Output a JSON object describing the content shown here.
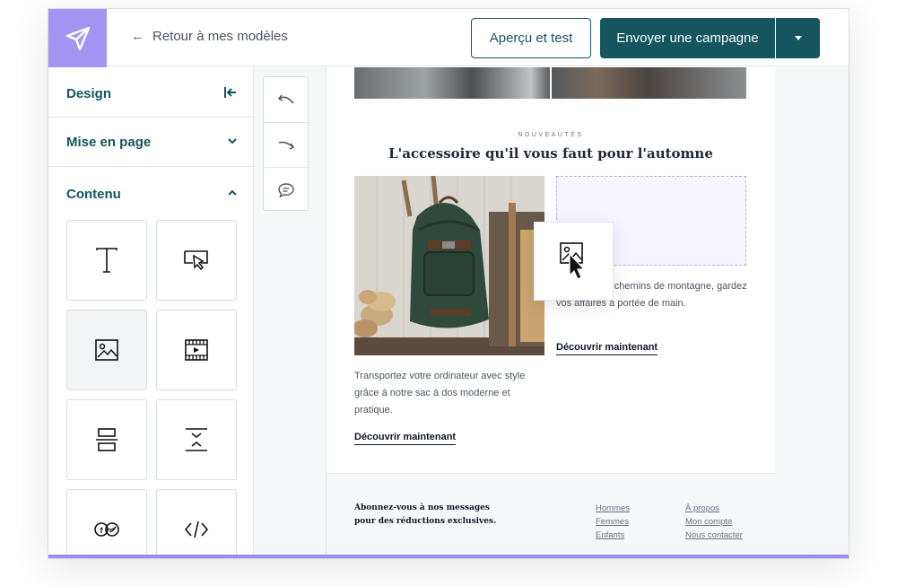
{
  "header": {
    "back_label": "Retour à mes modèles",
    "preview_label": "Aperçu et test",
    "send_label": "Envoyer une campagne"
  },
  "sidebar": {
    "design_label": "Design",
    "layout_label": "Mise en page",
    "content_label": "Contenu",
    "blocks": [
      {
        "icon": "text-icon"
      },
      {
        "icon": "button-icon"
      },
      {
        "icon": "image-icon"
      },
      {
        "icon": "video-icon"
      },
      {
        "icon": "divider-icon"
      },
      {
        "icon": "spacer-icon"
      },
      {
        "icon": "social-icon"
      },
      {
        "icon": "code-icon"
      }
    ]
  },
  "toolbar": {
    "tools": [
      {
        "icon": "undo-icon"
      },
      {
        "icon": "redo-icon"
      },
      {
        "icon": "comment-icon"
      }
    ]
  },
  "email": {
    "kicker": "NOUVEAUTÉS",
    "headline": "L'accessoire qu'il vous faut pour l'automne",
    "left_text": "Transportez votre ordinateur avec style grâce à notre sac à dos moderne et pratique.",
    "left_cta": "Découvrir maintenant",
    "right_text": "…me sur les chemins de montagne, gardez vos affaires à portée de main.",
    "right_cta": "Découvrir maintenant",
    "footer_text": "Abonnez-vous à nos messages pour des réductions exclusives.",
    "footer_links_col1": [
      "Hommes",
      "Femmes",
      "Enfants"
    ],
    "footer_links_col2": [
      "À propos",
      "Mon compte",
      "Nous contacter"
    ]
  },
  "colors": {
    "brand_teal": "#14555f",
    "accent_purple": "#a394f2"
  }
}
